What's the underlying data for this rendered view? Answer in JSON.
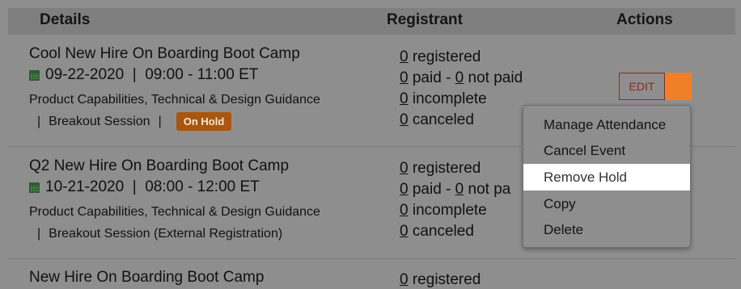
{
  "header": {
    "details": "Details",
    "registrant": "Registrant",
    "actions": "Actions"
  },
  "events": [
    {
      "title": "Cool New Hire On Boarding Boot Camp",
      "date_time": "09-22-2020  |  09:00 - 11:00 ET",
      "category": "Product Capabilities, Technical & Design Guidance",
      "session_type": "Breakout Session",
      "badge": "On Hold",
      "registered": {
        "count": "0",
        "label": " registered"
      },
      "paid": {
        "count": "0",
        "label": " paid - "
      },
      "not_paid": {
        "count": "0",
        "label": " not paid"
      },
      "incomplete": {
        "count": "0",
        "label": " incomplete"
      },
      "canceled": {
        "count": "0",
        "label": " canceled"
      }
    },
    {
      "title": "Q2 New Hire On Boarding Boot Camp",
      "date_time": "10-21-2020  |  08:00 - 12:00 ET",
      "category": "Product Capabilities, Technical & Design Guidance",
      "session_type": "Breakout Session (External Registration)",
      "registered": {
        "count": "0",
        "label": " registered"
      },
      "paid": {
        "count": "0",
        "label": " paid - "
      },
      "not_paid": {
        "count": "0",
        "label": " not pa"
      },
      "incomplete": {
        "count": "0",
        "label": " incomplete"
      },
      "canceled": {
        "count": "0",
        "label": " canceled"
      }
    },
    {
      "title": "New Hire On Boarding Boot Camp",
      "registered": {
        "count": "0",
        "label": " registered"
      }
    }
  ],
  "actions": {
    "edit_label": "EDIT"
  },
  "menu": {
    "items": [
      "Manage Attendance",
      "Cancel Event",
      "Remove Hold",
      "Copy",
      "Delete"
    ],
    "highlighted": "Remove Hold"
  },
  "colors": {
    "badge": "#a9560e",
    "edit_border": "#8a2a1e",
    "edit_toggle": "#f07f28",
    "overlay": "#8e8e8e"
  }
}
